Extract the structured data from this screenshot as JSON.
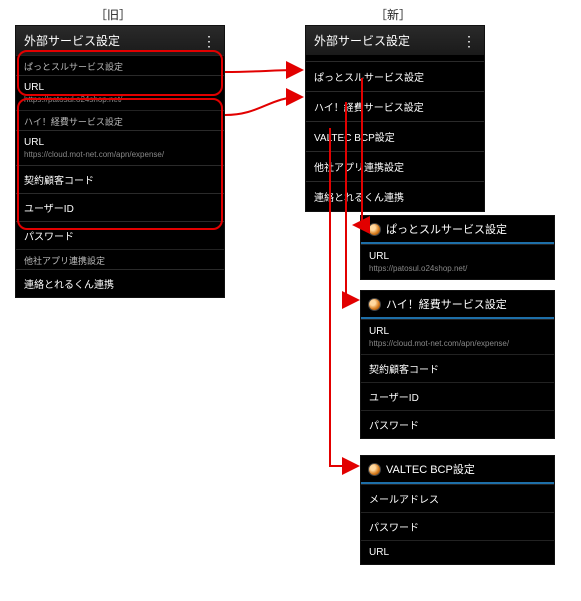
{
  "labels": {
    "old": "［旧］",
    "new": "［新］"
  },
  "old_panel": {
    "title": "外部サービス設定",
    "menu_icon": "⋮",
    "sections": [
      {
        "kind": "cat",
        "text": "ぱっとスルサービス設定"
      },
      {
        "kind": "field",
        "label": "URL",
        "sub": "https://patosul.o24shop.net/"
      },
      {
        "kind": "cat",
        "text": "ハイ！経費サービス設定"
      },
      {
        "kind": "field",
        "label": "URL",
        "sub": "https://cloud.mot-net.com/apn/expense/"
      },
      {
        "kind": "field",
        "label": "契約顧客コード"
      },
      {
        "kind": "field",
        "label": "ユーザーID"
      },
      {
        "kind": "field",
        "label": "パスワード"
      },
      {
        "kind": "cat",
        "text": "他社アプリ連携設定"
      },
      {
        "kind": "field",
        "label": "連絡とれるくん連携"
      }
    ]
  },
  "new_panel": {
    "title": "外部サービス設定",
    "menu_icon": "⋮",
    "items": [
      "ぱっとスルサービス設定",
      "ハイ！経費サービス設定",
      "VALTEC BCP設定",
      "他社アプリ連携設定",
      "連絡とれるくん連携"
    ]
  },
  "card1": {
    "title": "ぱっとスルサービス設定",
    "fields": [
      {
        "label": "URL",
        "sub": "https://patosul.o24shop.net/"
      }
    ]
  },
  "card2": {
    "title": "ハイ！経費サービス設定",
    "fields": [
      {
        "label": "URL",
        "sub": "https://cloud.mot-net.com/apn/expense/"
      },
      {
        "label": "契約顧客コード"
      },
      {
        "label": "ユーザーID"
      },
      {
        "label": "パスワード"
      }
    ]
  },
  "card3": {
    "title": "VALTEC BCP設定",
    "fields": [
      {
        "label": "メールアドレス"
      },
      {
        "label": "パスワード"
      },
      {
        "label": "URL"
      }
    ]
  }
}
